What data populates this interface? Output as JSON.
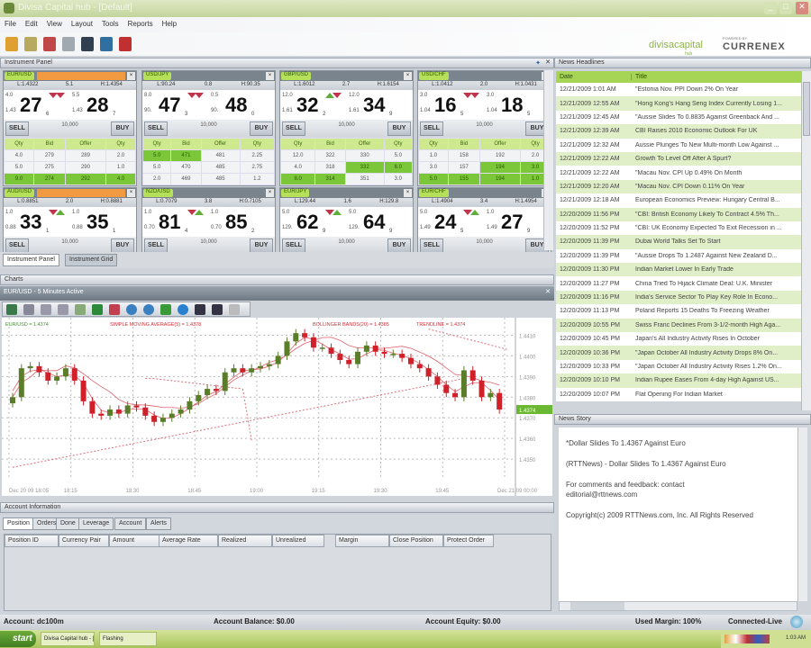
{
  "window": {
    "title": "Divisa Capital hub - [Default]"
  },
  "menu": [
    "File",
    "Edit",
    "View",
    "Layout",
    "Tools",
    "Reports",
    "Help"
  ],
  "toolbar_icons": [
    "pencil-icon",
    "settings-icon",
    "chart-icon",
    "gear-icon",
    "black-book-icon",
    "blue-book-icon",
    "red-book-icon"
  ],
  "logo": {
    "brand": "divisacapital",
    "sub": "hub",
    "powered": "POWERED BY",
    "partner": "CURRENEX"
  },
  "instrument_panel": {
    "title": "Instrument Panel",
    "sell": "SELL",
    "buy": "BUY",
    "depth_headers": [
      "Qty",
      "Bid",
      "Offer",
      "Qty"
    ],
    "tiles": [
      {
        "pair": "EUR/USD",
        "selected": true,
        "low": "L:1.4322",
        "spread": "5.1",
        "high": "H:1.4354",
        "bid": {
          "qty": "4.0",
          "pre": "1.43",
          "big": "27",
          "pip": "6",
          "dir": "down"
        },
        "offer": {
          "qty": "5.5",
          "pre": "1.43",
          "big": "28",
          "pip": "7",
          "dir": "down"
        },
        "amount": "10,000",
        "depth": [
          [
            "4.0",
            "279",
            "289",
            "2.0"
          ],
          [
            "5.0",
            "275",
            "290",
            "1.0"
          ],
          [
            "9.0",
            "274",
            "292",
            "4.0"
          ]
        ],
        "hl": [
          [],
          [],
          [
            0,
            1,
            2,
            3
          ]
        ]
      },
      {
        "pair": "USD/JPY",
        "selected": false,
        "low": "L:90.24",
        "spread": "0.8",
        "high": "H:90.35",
        "bid": {
          "qty": "8.0",
          "pre": "90.",
          "big": "47",
          "pip": "3",
          "dir": "down"
        },
        "offer": {
          "qty": "0.5",
          "pre": "90.",
          "big": "48",
          "pip": "0",
          "dir": "down"
        },
        "amount": "10,000",
        "depth": [
          [
            "5.0",
            "471",
            "481",
            "2.25"
          ],
          [
            "5.0",
            "470",
            "485",
            "2.75"
          ],
          [
            "2.0",
            "469",
            "485",
            "1.2"
          ]
        ],
        "hl": [
          [
            0,
            1
          ],
          [],
          []
        ]
      },
      {
        "pair": "GBP/USD",
        "selected": false,
        "low": "L:1.6012",
        "spread": "2.7",
        "high": "H:1.6154",
        "bid": {
          "qty": "12.0",
          "pre": "1.61",
          "big": "32",
          "pip": "2",
          "dir": "up"
        },
        "offer": {
          "qty": "12.0",
          "pre": "1.61",
          "big": "34",
          "pip": "9",
          "dir": "down"
        },
        "amount": "10,000",
        "depth": [
          [
            "12.0",
            "322",
            "330",
            "5.0"
          ],
          [
            "4.0",
            "318",
            "332",
            "6.0"
          ],
          [
            "8.0",
            "314",
            "351",
            "3.0"
          ]
        ],
        "hl": [
          [],
          [
            2,
            3
          ],
          [
            0,
            1
          ]
        ]
      },
      {
        "pair": "USD/CHF",
        "selected": false,
        "low": "L:1.0412",
        "spread": "2.0",
        "high": "H:1.0431",
        "bid": {
          "qty": "3.0",
          "pre": "1.04",
          "big": "16",
          "pip": "5",
          "dir": "down"
        },
        "offer": {
          "qty": "3.0",
          "pre": "1.04",
          "big": "18",
          "pip": "5",
          "dir": "down"
        },
        "amount": "10,000",
        "depth": [
          [
            "1.0",
            "158",
            "192",
            "2.0"
          ],
          [
            "3.0",
            "157",
            "194",
            "3.0"
          ],
          [
            "5.0",
            "155",
            "194",
            "1.0"
          ]
        ],
        "hl": [
          [],
          [
            2,
            3
          ],
          [
            0,
            1,
            2,
            3
          ]
        ]
      },
      {
        "pair": "AUD/USD",
        "selected": true,
        "low": "L:0.8851",
        "spread": "2.0",
        "high": "H:0.8881",
        "bid": {
          "qty": "1.0",
          "pre": "0.88",
          "big": "33",
          "pip": "1",
          "dir": "down"
        },
        "offer": {
          "qty": "1.0",
          "pre": "0.88",
          "big": "35",
          "pip": "1",
          "dir": "up"
        },
        "amount": "10,000"
      },
      {
        "pair": "NZD/USD",
        "selected": false,
        "low": "L:0.7079",
        "spread": "3.8",
        "high": "H:0.7105",
        "bid": {
          "qty": "1.0",
          "pre": "0.70",
          "big": "81",
          "pip": "4",
          "dir": "down"
        },
        "offer": {
          "qty": "1.0",
          "pre": "0.70",
          "big": "85",
          "pip": "2",
          "dir": "up"
        },
        "amount": "10,000"
      },
      {
        "pair": "EUR/JPY",
        "selected": false,
        "low": "L:129.44",
        "spread": "1.6",
        "high": "H:129.8",
        "bid": {
          "qty": "5.0",
          "pre": "129.",
          "big": "62",
          "pip": "9",
          "dir": "down"
        },
        "offer": {
          "qty": "5.0",
          "pre": "129.",
          "big": "64",
          "pip": "9",
          "dir": "up"
        },
        "amount": "10,000"
      },
      {
        "pair": "EUR/CHF",
        "selected": false,
        "low": "L:1.4904",
        "spread": "3.4",
        "high": "H:1.4954",
        "bid": {
          "qty": "5.0",
          "pre": "1.49",
          "big": "24",
          "pip": "5",
          "dir": "down"
        },
        "offer": {
          "qty": "1.0",
          "pre": "1.49",
          "big": "27",
          "pip": "9",
          "dir": "up"
        },
        "amount": "10,000"
      }
    ],
    "tabs": [
      "Instrument Panel",
      "Instrument Grid"
    ]
  },
  "charts": {
    "title": "Charts",
    "window_title": "EUR/USD - 5 Minutes Active"
  },
  "chart_data": {
    "type": "candlestick",
    "title": "EUR/USD - 5 Minutes",
    "legend": [
      "EUR/USD = 1.4374",
      "SIMPLE MOVING AVERAGE(5) = 1.4378",
      "BOLLINGER BANDS(20) = 1.4385",
      "TRENDLINE = 1.4374"
    ],
    "colors": {
      "up": "#5a7d2a",
      "down": "#d0202a",
      "ma": "#e0606a",
      "trend": "#d9707a",
      "current": "#6ab832"
    },
    "close": [
      1.438,
      1.4394,
      1.4395,
      1.4392,
      1.4388,
      1.439,
      1.4394,
      1.4388,
      1.4378,
      1.4372,
      1.4371,
      1.4374,
      1.4372,
      1.4376,
      1.4375,
      1.4371,
      1.4368,
      1.437,
      1.4372,
      1.4374,
      1.4378,
      1.4381,
      1.4384,
      1.4383,
      1.4392,
      1.4394,
      1.4392,
      1.4394,
      1.4395,
      1.4396,
      1.44,
      1.4407,
      1.4411,
      1.4409,
      1.4404,
      1.4404,
      1.4401,
      1.4398,
      1.4396,
      1.4402,
      1.4405,
      1.4402,
      1.4401,
      1.4401,
      1.4399,
      1.4396,
      1.4394,
      1.439,
      1.4386,
      1.4382,
      1.438,
      1.4393,
      1.4388,
      1.438,
      1.4382,
      1.4374
    ],
    "ylim": [
      1.434,
      1.4415
    ],
    "yticks": [
      "1.4410",
      "1.4400",
      "1.4390",
      "1.4380",
      "1.4370",
      "1.4360",
      "1.4350"
    ],
    "current": "1.4374",
    "xticks": [
      "Dec 20 09 18:05",
      "18:15",
      "18:30",
      "18:45",
      "19:00",
      "19:15",
      "19:30",
      "19:45",
      "Dec 21 09 00:00"
    ]
  },
  "account": {
    "title": "Account Information",
    "tabs": [
      "Position",
      "Orders",
      "Done",
      "Leverage",
      "Account",
      "Alerts"
    ],
    "columns": [
      "Position ID",
      "Currency Pair",
      "Amount",
      "Average Rate",
      "Realized",
      "Unrealized",
      "Margin",
      "Close Position",
      "Protect Order"
    ]
  },
  "news": {
    "title": "News Headlines",
    "columns": [
      "Date",
      "Title"
    ],
    "rows": [
      [
        "12/21/2009 1:01 AM",
        "\"Estonia Nov. PPI Down 2% On Year"
      ],
      [
        "12/21/2009 12:55 AM",
        "\"Hong Kong's Hang Seng Index Currently Losing 1..."
      ],
      [
        "12/21/2009 12:45 AM",
        "\"Aussie Slides To 0.8835 Against Greenback And ..."
      ],
      [
        "12/21/2009 12:39 AM",
        "CBI Raises 2010 Economic Outlook For UK"
      ],
      [
        "12/21/2009 12:32 AM",
        "Aussie Plunges To New Multi-month Low Against ..."
      ],
      [
        "12/21/2009 12:22 AM",
        "Growth To Level Off After A Spurt?"
      ],
      [
        "12/21/2009 12:22 AM",
        "\"Macau Nov. CPI Up 0.49% On Month"
      ],
      [
        "12/21/2009 12:20 AM",
        "\"Macau Nov. CPI Down 0.11% On Year"
      ],
      [
        "12/21/2009 12:18 AM",
        "European Economics Preview: Hungary Central B..."
      ],
      [
        "12/20/2009 11:56 PM",
        "\"CBI: British Economy Likely To Contract 4.5% Th..."
      ],
      [
        "12/20/2009 11:52 PM",
        "\"CBI: UK Economy Expected To Exit Recession in ..."
      ],
      [
        "12/20/2009 11:39 PM",
        "Dubai World Talks Set To Start"
      ],
      [
        "12/20/2009 11:39 PM",
        "\"Aussie Drops To 1.2487 Against New Zealand D..."
      ],
      [
        "12/20/2009 11:30 PM",
        "Indian Market Lower In Early Trade"
      ],
      [
        "12/20/2009 11:27 PM",
        "China Tried To Hijack Climate Deal: U.K. Minister"
      ],
      [
        "12/20/2009 11:16 PM",
        "India's Service Sector To Play Key Role In Econo..."
      ],
      [
        "12/20/2009 11:13 PM",
        "Poland Reports 15 Deaths To Freezing Weather"
      ],
      [
        "12/20/2009 10:55 PM",
        "Swiss Franc Declines From 3-1/2-month High Aga..."
      ],
      [
        "12/20/2009 10:45 PM",
        "Japan's All Industry Activity Rises In October"
      ],
      [
        "12/20/2009 10:36 PM",
        "\"Japan October All Industry Activity Drops 8% On..."
      ],
      [
        "12/20/2009 10:33 PM",
        "\"Japan October All Industry Activity Rises 1.2% On..."
      ],
      [
        "12/20/2009 10:10 PM",
        "Indian Rupee Eases From 4-day High Against US..."
      ],
      [
        "12/20/2009 10:07 PM",
        "Flat Opening For Indian Market"
      ]
    ]
  },
  "story": {
    "title": "News Story",
    "headline": "*Dollar Slides To 1.4367 Against Euro",
    "lead": "(RTTNews) - Dollar Slides To 1.4367 Against Euro",
    "contact": "For comments and feedback: contact editorial@rttnews.com",
    "copyright": "Copyright(c) 2009 RTTNews.com, Inc. All Rights Reserved"
  },
  "status": {
    "account": "Account: dc100m",
    "balance": "Account Balance: $0.00",
    "equity": "Account Equity: $0.00",
    "margin": "Used Margin: 100%",
    "connection": "Connected-Live"
  },
  "taskbar": {
    "start": "start",
    "items": [
      "Divisa Capital hub - [...",
      "Flashing"
    ],
    "clock": "1:03 AM"
  }
}
